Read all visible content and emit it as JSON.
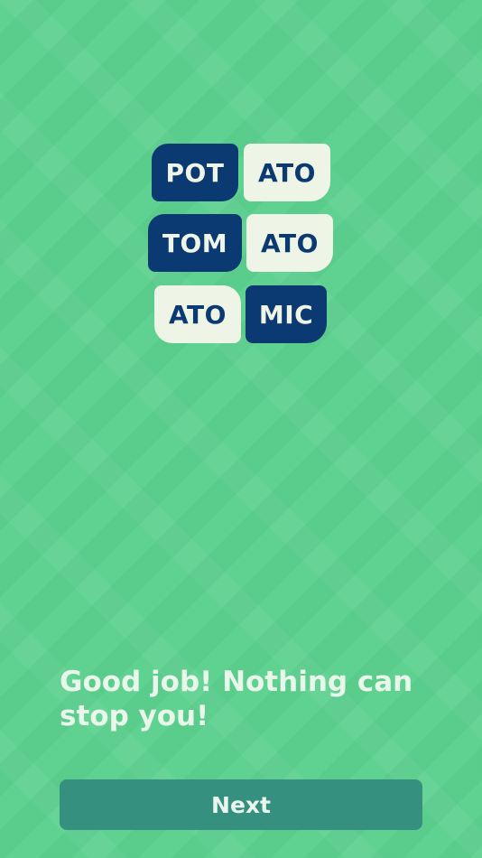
{
  "tiles": [
    {
      "text": "POT",
      "style": "dark"
    },
    {
      "text": "ATO",
      "style": "light"
    },
    {
      "text": "TOM",
      "style": "dark"
    },
    {
      "text": "ATO",
      "style": "light"
    },
    {
      "text": "ATO",
      "style": "light"
    },
    {
      "text": "MIC",
      "style": "dark"
    }
  ],
  "message": "Good job! Nothing can stop you!",
  "next_button": {
    "label": "Next"
  },
  "colors": {
    "background": "#5fd291",
    "tile_dark": "#0b3a73",
    "tile_light": "#eef5e6",
    "button": "#36907f",
    "message_text": "#e9f7ea"
  }
}
